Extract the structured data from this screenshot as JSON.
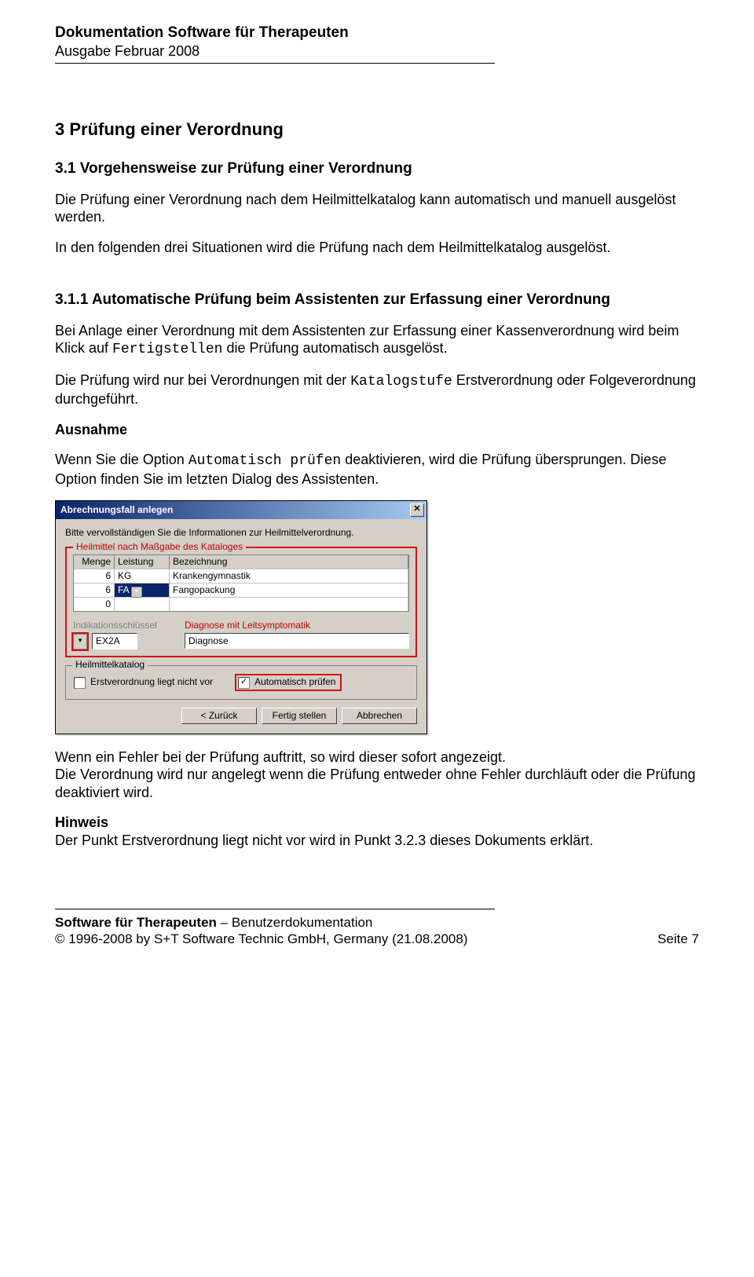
{
  "header": {
    "title": "Dokumentation Software für Therapeuten",
    "edition": "Ausgabe Februar 2008"
  },
  "section": {
    "num_title": "3  Prüfung einer Verordnung",
    "h2": "3.1  Vorgehensweise zur Prüfung einer Verordnung",
    "p1": "Die Prüfung einer Verordnung nach dem Heilmittelkatalog kann automatisch und manuell ausgelöst werden.",
    "p2": "In den folgenden drei Situationen wird die Prüfung nach dem Heilmittelkatalog ausgelöst.",
    "h3": "3.1.1  Automatische Prüfung beim Assistenten zur Erfassung einer Verordnung",
    "p3a": "Bei Anlage einer Verordnung mit dem Assistenten zur Erfassung einer Kassenverordnung wird beim Klick auf ",
    "p3_code": "Fertigstellen",
    "p3b": " die Prüfung automatisch ausgelöst.",
    "p4a": "Die Prüfung wird nur bei Verordnungen mit der ",
    "p4_code": "Katalogstufe",
    "p4b": " Erstverordnung oder Folgeverordnung durchgeführt.",
    "ausnahme": "Ausnahme",
    "p5a": "Wenn Sie die Option ",
    "p5_code": "Automatisch prüfen",
    "p5b": " deaktivieren,  wird die Prüfung übersprungen. Diese Option finden Sie im letzten Dialog des Assistenten.",
    "p6": "Wenn ein Fehler bei der Prüfung auftritt, so wird dieser sofort angezeigt.",
    "p7": "Die Verordnung wird nur angelegt wenn die Prüfung entweder ohne Fehler durchläuft oder die Prüfung deaktiviert wird.",
    "hinweis": "Hinweis",
    "p8": "Der Punkt Erstverordnung liegt nicht vor wird in Punkt 3.2.3 dieses Dokuments erklärt."
  },
  "dialog": {
    "title": "Abrechnungsfall anlegen",
    "intro": "Bitte vervollständigen Sie die Informationen zur Heilmittelverordnung.",
    "fs1_legend": "Heilmittel nach Maßgabe des Kataloges",
    "grid": {
      "headers": {
        "menge": "Menge",
        "leistung": "Leistung",
        "bez": "Bezeichnung"
      },
      "rows": [
        {
          "menge": "6",
          "leistung": "KG",
          "bez": "Krankengymnastik"
        },
        {
          "menge": "6",
          "leistung": "FA",
          "bez": "Fangopackung"
        },
        {
          "menge": "0",
          "leistung": "",
          "bez": ""
        }
      ]
    },
    "ind_label": "Indikationsschlüssel",
    "diag_label": "Diagnose mit Leitsymptomatik",
    "ind_value": "EX2A",
    "diag_value": "Diagnose",
    "fs2_legend": "Heilmittelkatalog",
    "chk_erst": "Erstverordnung liegt nicht vor",
    "chk_auto": "Automatisch prüfen",
    "btn_back": "< Zurück",
    "btn_finish": "Fertig stellen",
    "btn_cancel": "Abbrechen"
  },
  "footer": {
    "line1a": "Software für Therapeuten",
    "line1b": " – Benutzerdokumentation",
    "line2": "© 1996-2008 by S+T Software Technic GmbH, Germany (21.08.2008)",
    "page": "Seite 7"
  }
}
